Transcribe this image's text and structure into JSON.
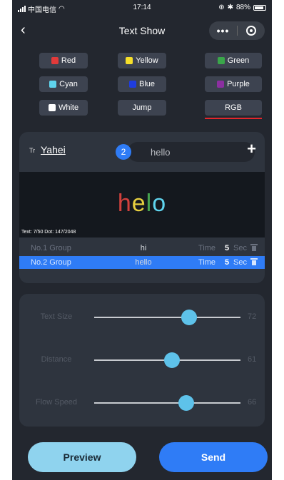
{
  "status_bar": {
    "carrier": "中国电信",
    "time": "17:14",
    "battery": "88%"
  },
  "nav": {
    "back_icon": "chevron-left-icon",
    "title": "Text Show",
    "more_label": "•••",
    "close_icon": "target-circle-icon"
  },
  "colors": [
    {
      "label": "Red",
      "swatch": "#e23a3a"
    },
    {
      "label": "Yellow",
      "swatch": "#f6df2a"
    },
    {
      "label": "Green",
      "swatch": "#3aa64a"
    },
    {
      "label": "Cyan",
      "swatch": "#5fd4ee"
    },
    {
      "label": "Blue",
      "swatch": "#1f3de0"
    },
    {
      "label": "Purple",
      "swatch": "#8c2fa0"
    },
    {
      "label": "White",
      "swatch": "#ffffff"
    },
    {
      "label": "Jump",
      "swatch": ""
    },
    {
      "label": "RGB",
      "swatch": ""
    }
  ],
  "selected_color": "RGB",
  "text_editor": {
    "font_icon": "Tr",
    "font": "Yahei",
    "group_number": "2",
    "input_value": "hello",
    "add_icon": "plus-icon"
  },
  "preview": {
    "text": "helo",
    "letter_colors": [
      "#d2413d",
      "#e6cf3f",
      "#46a34e",
      "#5fd4ee"
    ],
    "info": "Text: 7/50  Dot: 147/2048"
  },
  "groups": [
    {
      "name": "No.1 Group",
      "text": "hi",
      "time_label": "Time",
      "time": "5",
      "unit": "Sec",
      "active": false
    },
    {
      "name": "No.2 Group",
      "text": "hello",
      "time_label": "Time",
      "time": "5",
      "unit": "Sec",
      "active": true
    }
  ],
  "sliders": [
    {
      "label": "Text Size",
      "value": 72,
      "level": 0.65
    },
    {
      "label": "Distance",
      "value": 61,
      "level": 0.53
    },
    {
      "label": "Flow Speed",
      "value": 66,
      "level": 0.63
    }
  ],
  "buttons": {
    "preview": "Preview",
    "send": "Send"
  },
  "accent": "#2f7cf6",
  "slider_thumb_color": "#5ec2ea"
}
